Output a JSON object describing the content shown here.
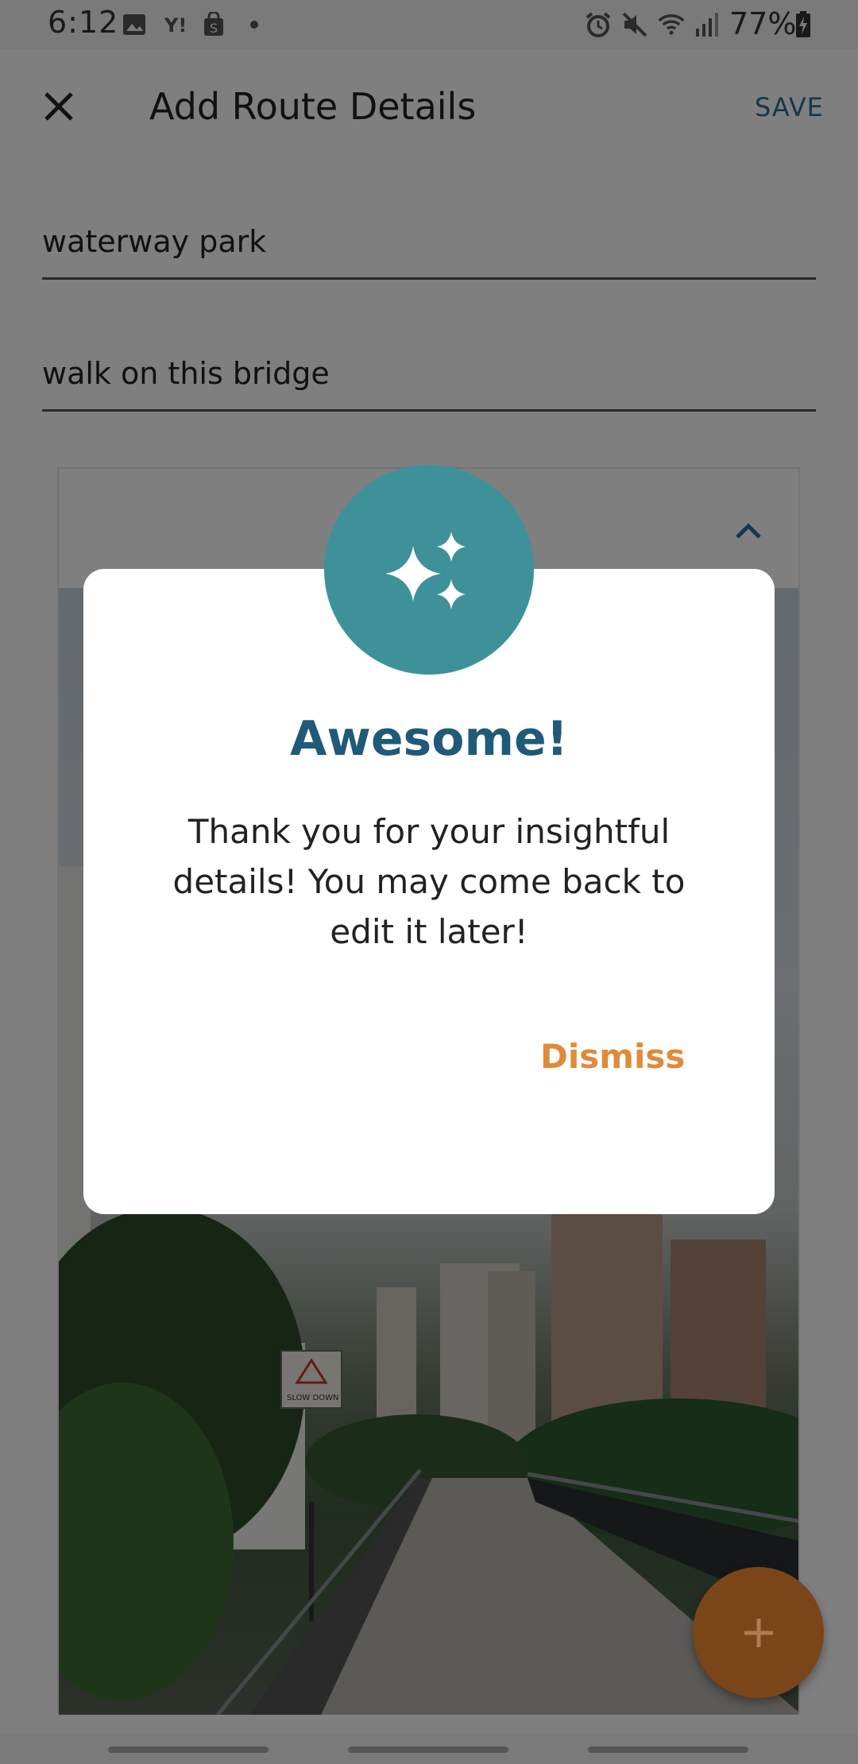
{
  "status_bar": {
    "time": "6:12",
    "battery": "77%",
    "left_icons": [
      "image-icon",
      "yahoo-icon",
      "shopping-bag-icon",
      "dot-icon"
    ],
    "right_icons": [
      "alarm-icon",
      "mute-icon",
      "wifi-icon",
      "signal-icon",
      "battery-charging-icon"
    ]
  },
  "app_bar": {
    "title": "Add Route Details",
    "save_label": "SAVE",
    "close_icon": "close-icon"
  },
  "form": {
    "name_value": "waterway park",
    "description_value": "walk on this bridge"
  },
  "card": {
    "collapse_icon": "chevron-up-icon",
    "photo_sign_text": "SLOW DOWN"
  },
  "dialog": {
    "icon": "sparkles-icon",
    "title": "Awesome!",
    "message": "Thank you for your insightful details! You may come back to edit it later!",
    "dismiss_label": "Dismiss"
  },
  "fab": {
    "icon": "plus-icon"
  },
  "colors": {
    "accent_blue": "#2a6f97",
    "dialog_title": "#1f5a78",
    "badge_teal": "#3f9199",
    "dismiss_orange": "#e08a3a",
    "fab_orange": "#7a4518"
  }
}
